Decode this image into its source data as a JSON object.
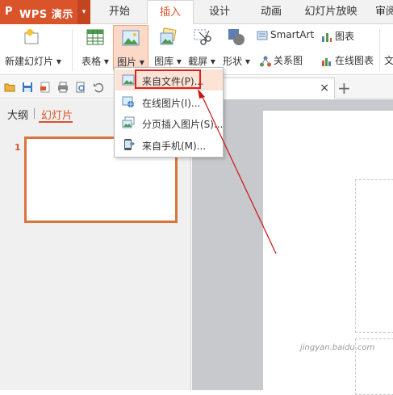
{
  "app": {
    "logo": "P",
    "name": "WPS 演示",
    "menu_caret": "▾"
  },
  "tabs": [
    {
      "label": "开始"
    },
    {
      "label": "插入"
    },
    {
      "label": "设计"
    },
    {
      "label": "动画"
    },
    {
      "label": "幻灯片放映"
    },
    {
      "label": "审阅"
    }
  ],
  "ribbon": {
    "new_slide": "新建幻灯片 ▾",
    "table": "表格 ▾",
    "picture": "图片 ▾",
    "gallery": "图库 ▾",
    "screenshot": "截屏 ▾",
    "shapes": "形状 ▾",
    "smartart": "SmartArt",
    "chart": "图表",
    "relation": "关系图",
    "online_chart": "在线图表",
    "text": "文"
  },
  "doc_tab": {
    "close": "×",
    "plus": "+"
  },
  "left_panel": {
    "tab_outline": "大纲",
    "tab_slides": "幻灯片",
    "slide_number": "1"
  },
  "menu": {
    "items": [
      {
        "label": "来自文件(P)..."
      },
      {
        "label": "在线图片(I)..."
      },
      {
        "label": "分页插入图片(S)..."
      },
      {
        "label": "来自手机(M)..."
      }
    ]
  },
  "colors": {
    "accent": "#d9532b",
    "highlight_box": "#e01e1e",
    "arrow": "#cc1111"
  },
  "watermark": "jingyan.baidu.com"
}
